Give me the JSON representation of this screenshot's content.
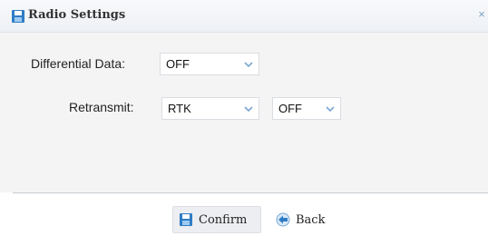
{
  "dialog": {
    "title": "Radio Settings",
    "close_glyph": "×"
  },
  "form": {
    "differential_data": {
      "label": "Differential Data:",
      "value": "OFF"
    },
    "retransmit": {
      "label": "Retransmit:",
      "mode_value": "RTK",
      "state_value": "OFF"
    }
  },
  "footer": {
    "confirm_label": "Confirm",
    "back_label": "Back"
  },
  "icons": {
    "title": "save-icon",
    "close": "close-icon",
    "dropdown": "chevron-down-icon",
    "confirm": "save-icon",
    "back": "back-arrow-icon"
  },
  "colors": {
    "accent": "#2f7dc6",
    "chevron": "#7aa7d6"
  }
}
